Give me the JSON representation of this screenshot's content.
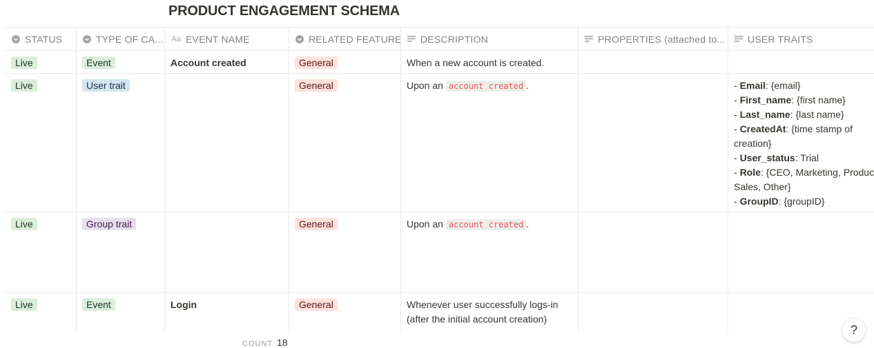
{
  "page": {
    "title": "PRODUCT ENGAGEMENT SCHEMA"
  },
  "columns": [
    {
      "label": "STATUS",
      "icon": "select-icon"
    },
    {
      "label": "TYPE OF CA...",
      "icon": "select-icon"
    },
    {
      "label": "EVENT NAME",
      "icon": "title-icon"
    },
    {
      "label": "RELATED FEATURE",
      "icon": "select-icon"
    },
    {
      "label": "DESCRIPTION",
      "icon": "text-icon"
    },
    {
      "label": "PROPERTIES (attached to...",
      "icon": "text-icon"
    },
    {
      "label": "USER TRAITS",
      "icon": "text-icon"
    }
  ],
  "rows": [
    {
      "status": "Live",
      "type": "Event",
      "event_name": "Account created",
      "feature": "General",
      "description": "When a new account is created."
    },
    {
      "status": "Live",
      "type": "User trait",
      "event_name": "",
      "feature": "General",
      "description_prefix": "Upon an ",
      "description_code": "account created",
      "description_suffix": ".",
      "traits": [
        {
          "key": "Email",
          "value": ": {email}"
        },
        {
          "key": "First_name",
          "value": ": {first name}"
        },
        {
          "key": "Last_name",
          "value": ": {last name}"
        },
        {
          "key": "CreatedAt",
          "value": ": {time stamp of"
        },
        {
          "key": "",
          "value": "creation}"
        },
        {
          "key": "User_status",
          "value": ": Trial"
        },
        {
          "key": "Role",
          "value": ": {CEO, Marketing, Produc"
        },
        {
          "key": "",
          "value": "Sales, Other}"
        },
        {
          "key": "GroupID",
          "value": ": {groupID}"
        }
      ]
    },
    {
      "status": "Live",
      "type": "Group trait",
      "event_name": "",
      "feature": "General",
      "description_prefix": "Upon an ",
      "description_code": "account created",
      "description_suffix": "."
    },
    {
      "status": "Live",
      "type": "Event",
      "event_name": "Login",
      "feature": "General",
      "description_line1": "Whenever user successfully logs-in",
      "description_line2": "(after the initial account creation)"
    }
  ],
  "footer": {
    "count_label": "COUNT",
    "count_value": "18"
  },
  "help_button": {
    "label": "?"
  },
  "colors": {
    "live": "#dbeddb",
    "user_trait": "#d3e5ef",
    "group_trait": "#e8deee",
    "general": "#ffe2dd"
  }
}
